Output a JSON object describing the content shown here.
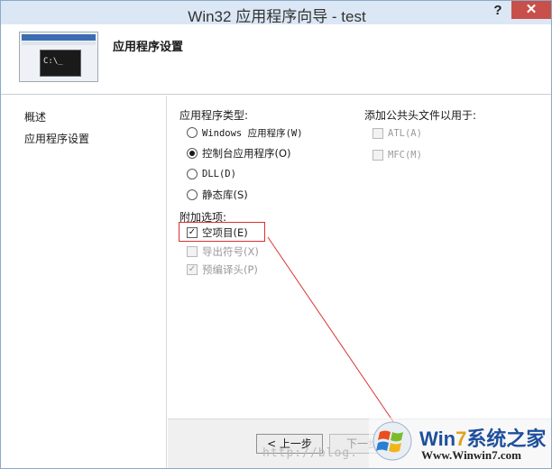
{
  "window": {
    "title": "Win32 应用程序向导 - test",
    "help_label": "?",
    "close_label": "✕"
  },
  "header": {
    "title": "应用程序设置",
    "graphic_text": "C:\\_"
  },
  "nav": {
    "items": [
      {
        "label": "概述"
      },
      {
        "label": "应用程序设置"
      }
    ]
  },
  "app_type": {
    "label": "应用程序类型:",
    "options": [
      {
        "label": "Windows 应用程序(W)",
        "selected": false
      },
      {
        "label": "控制台应用程序(O)",
        "selected": true
      },
      {
        "label": "DLL(D)",
        "selected": false
      },
      {
        "label": "静态库(S)",
        "selected": false
      }
    ]
  },
  "extra_options": {
    "label": "附加选项:",
    "items": [
      {
        "label": "空项目(E)",
        "checked": true,
        "enabled": true
      },
      {
        "label": "导出符号(X)",
        "checked": false,
        "enabled": false
      },
      {
        "label": "预编译头(P)",
        "checked": true,
        "enabled": false
      }
    ]
  },
  "common_headers": {
    "label": "添加公共头文件以用于:",
    "items": [
      {
        "label": "ATL(A)",
        "checked": false,
        "enabled": false
      },
      {
        "label": "MFC(M)",
        "checked": false,
        "enabled": false
      }
    ]
  },
  "buttons": {
    "prev": "< 上一步",
    "next": "下一步"
  },
  "watermark": {
    "url": "http://blog.",
    "brand_name_a": "Win",
    "brand_name_b": "7",
    "brand_name_c": "系统之家",
    "brand_url": "Www.Winwin7.com"
  },
  "colors": {
    "highlight": "#d9322f",
    "close_button": "#c7504a",
    "titlebar": "#dbe7f4",
    "brand_blue": "#1e4f9c"
  }
}
